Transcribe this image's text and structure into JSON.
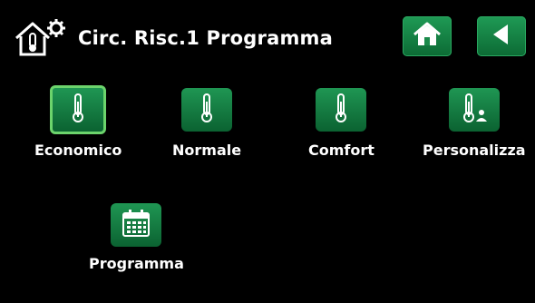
{
  "header": {
    "title": "Circ. Risc.1 Programma",
    "icons": [
      "house-thermometer-icon",
      "gear-icon"
    ]
  },
  "nav": {
    "home_icon": "home-icon",
    "back_icon": "back-arrow-icon"
  },
  "tiles": [
    {
      "label": "Economico",
      "icon": "thermometer-icon",
      "selected": true
    },
    {
      "label": "Normale",
      "icon": "thermometer-icon",
      "selected": false
    },
    {
      "label": "Comfort",
      "icon": "thermometer-icon",
      "selected": false
    },
    {
      "label": "Personalizza",
      "icon": "thermometer-user-icon",
      "selected": false
    },
    {
      "label": "Programma",
      "icon": "calendar-icon",
      "selected": false
    }
  ],
  "colors": {
    "background": "#000000",
    "button_green": "#1a8a4a",
    "selected_border": "#6cd46c",
    "text": "#ffffff"
  }
}
